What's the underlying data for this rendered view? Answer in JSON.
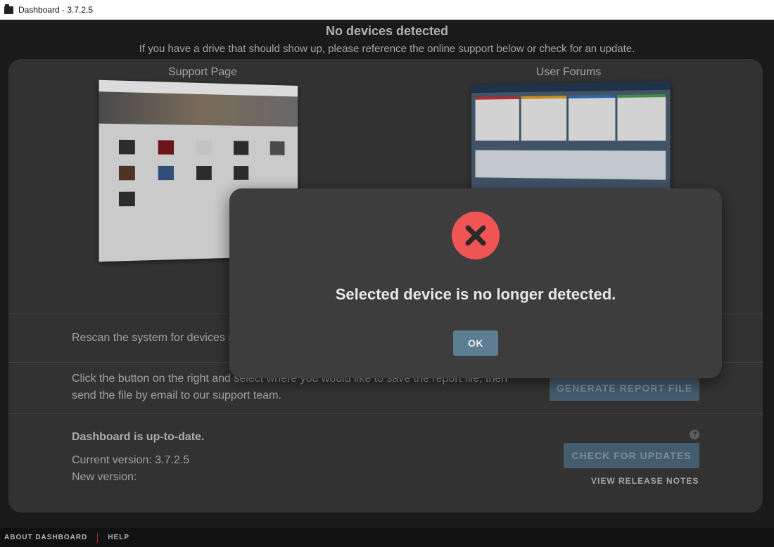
{
  "window": {
    "title": "Dashboard - 3.7.2.5"
  },
  "header": {
    "heading": "No devices detected",
    "subtitle": "If you have a drive that should show up, please reference the online support below or check for an update."
  },
  "support": {
    "support_page_label": "Support Page",
    "user_forums_label": "User Forums"
  },
  "rescan": {
    "text": "Rescan the system for devices a"
  },
  "report": {
    "text_line1": "Click the button on the right and select where you would like to save the report file, then",
    "text_line2": "send the file by email to our support team.",
    "button": "GENERATE REPORT FILE"
  },
  "update": {
    "status": "Dashboard is up-to-date.",
    "current_version": "Current version: 3.7.2.5",
    "new_version": "New version:",
    "check_button": "CHECK FOR UPDATES",
    "release_notes": "VIEW RELEASE NOTES",
    "help_glyph": "?"
  },
  "footer": {
    "about": "ABOUT DASHBOARD",
    "help": "HELP"
  },
  "modal": {
    "message": "Selected device is no longer detected.",
    "ok": "OK",
    "icon": "error-x-icon"
  },
  "colors": {
    "error": "#f05454",
    "button": "#4e6a7e",
    "ok_button": "#5d7d92"
  }
}
